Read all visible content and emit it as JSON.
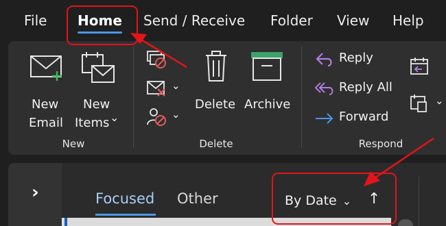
{
  "menu": {
    "tabs": [
      {
        "label": "File"
      },
      {
        "label": "Home"
      },
      {
        "label": "Send / Receive"
      },
      {
        "label": "Folder"
      },
      {
        "label": "View"
      },
      {
        "label": "Help"
      }
    ],
    "active_tab": "Home"
  },
  "ribbon": {
    "new_group": {
      "label": "New",
      "new_email": {
        "line1": "New",
        "line2": "Email",
        "icon": "mail-plus-icon"
      },
      "new_items": {
        "line1": "New",
        "line2": "Items",
        "chevron": "⌄",
        "icon": "new-items-icon"
      }
    },
    "delete_group": {
      "label": "Delete",
      "ignore_icon": "ignore-icon",
      "cleanup_icon": "cleanup-icon",
      "junk_icon": "junk-icon",
      "delete": {
        "label": "Delete",
        "icon": "trash-icon"
      },
      "archive": {
        "label": "Archive",
        "icon": "archive-icon"
      }
    },
    "respond_group": {
      "label": "Respond",
      "reply": {
        "label": "Reply",
        "icon": "reply-icon"
      },
      "reply_all": {
        "label": "Reply All",
        "icon": "reply-all-icon"
      },
      "forward": {
        "label": "Forward",
        "icon": "forward-icon"
      }
    }
  },
  "mail_list": {
    "expand_glyph": "›",
    "tabs": [
      {
        "label": "Focused",
        "active": true
      },
      {
        "label": "Other",
        "active": false
      }
    ],
    "sort": {
      "label": "By Date",
      "chevron": "⌄",
      "direction_glyph": "↑"
    }
  },
  "colors": {
    "background": "#1f1f1f",
    "ribbon": "#2f2f2f",
    "accent": "#4c97e8",
    "reply_icon": "#b07ee0",
    "archive_icon": "#3da36a",
    "red_glyph": "#e25b5b",
    "annotation": "#e4141b"
  }
}
